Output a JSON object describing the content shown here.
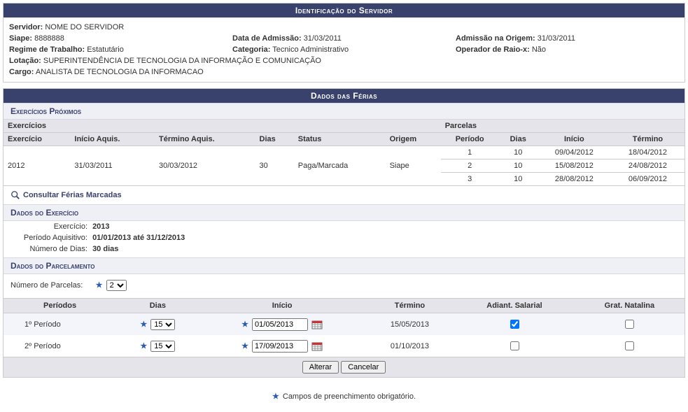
{
  "ident": {
    "header": "Identificação do Servidor",
    "servidor_lbl": "Servidor:",
    "servidor": "NOME DO SERVIDOR",
    "siape_lbl": "Siape:",
    "siape": "8888888",
    "data_adm_lbl": "Data de Admissão:",
    "data_adm": "31/03/2011",
    "adm_origem_lbl": "Admissão na Origem:",
    "adm_origem": "31/03/2011",
    "regime_lbl": "Regime de Trabalho:",
    "regime": "Estatutário",
    "categoria_lbl": "Categoria:",
    "categoria": "Tecnico Administrativo",
    "raiox_lbl": "Operador de Raio-x:",
    "raiox": "Não",
    "lotacao_lbl": "Lotação:",
    "lotacao": "SUPERINTENDÊNCIA DE TECNOLOGIA DA INFORMAÇÃO E COMUNICAÇÃO",
    "cargo_lbl": "Cargo:",
    "cargo": "ANALISTA DE TECNOLOGIA DA INFORMACAO"
  },
  "ferias": {
    "header": "Dados das Férias",
    "sec_prox": "Exercícios Próximos",
    "grp_exerc": "Exercícios",
    "grp_parcelas": "Parcelas",
    "cols": {
      "exercicio": "Exercício",
      "inicio_aq": "Início Aquis.",
      "termino_aq": "Término Aquis.",
      "dias": "Dias",
      "status": "Status",
      "origem": "Origem",
      "periodo": "Período",
      "pdias": "Dias",
      "inicio": "Início",
      "termino": "Término"
    },
    "row": {
      "exercicio": "2012",
      "inicio_aq": "31/03/2011",
      "termino_aq": "30/03/2012",
      "dias": "30",
      "status": "Paga/Marcada",
      "origem": "Siape",
      "parcelas": [
        {
          "periodo": "1",
          "dias": "10",
          "inicio": "09/04/2012",
          "termino": "18/04/2012"
        },
        {
          "periodo": "2",
          "dias": "10",
          "inicio": "15/08/2012",
          "termino": "24/08/2012"
        },
        {
          "periodo": "3",
          "dias": "10",
          "inicio": "28/08/2012",
          "termino": "06/09/2012"
        }
      ]
    },
    "consultar_link": "Consultar Férias Marcadas"
  },
  "exerc": {
    "sec": "Dados do Exercício",
    "exercicio_lbl": "Exercício:",
    "exercicio": "2013",
    "periodo_lbl": "Período Aquisitivo:",
    "periodo": "01/01/2013 até 31/12/2013",
    "numdias_lbl": "Número de Dias:",
    "numdias": "30 dias"
  },
  "parcel": {
    "sec": "Dados do Parcelamento",
    "num_lbl": "Número de Parcelas:",
    "num_sel": "2",
    "cols": {
      "periodos": "Períodos",
      "dias": "Dias",
      "inicio": "Início",
      "termino": "Término",
      "adiant": "Adiant. Salarial",
      "grat": "Grat. Natalina"
    },
    "rows": [
      {
        "periodo": "1º Período",
        "dias": "15",
        "inicio": "01/05/2013",
        "termino": "15/05/2013",
        "adiant": true,
        "grat": false
      },
      {
        "periodo": "2º Período",
        "dias": "15",
        "inicio": "17/09/2013",
        "termino": "01/10/2013",
        "adiant": false,
        "grat": false
      }
    ],
    "btn_alterar": "Alterar",
    "btn_cancelar": "Cancelar"
  },
  "footnote": "Campos de preenchimento obrigatório."
}
